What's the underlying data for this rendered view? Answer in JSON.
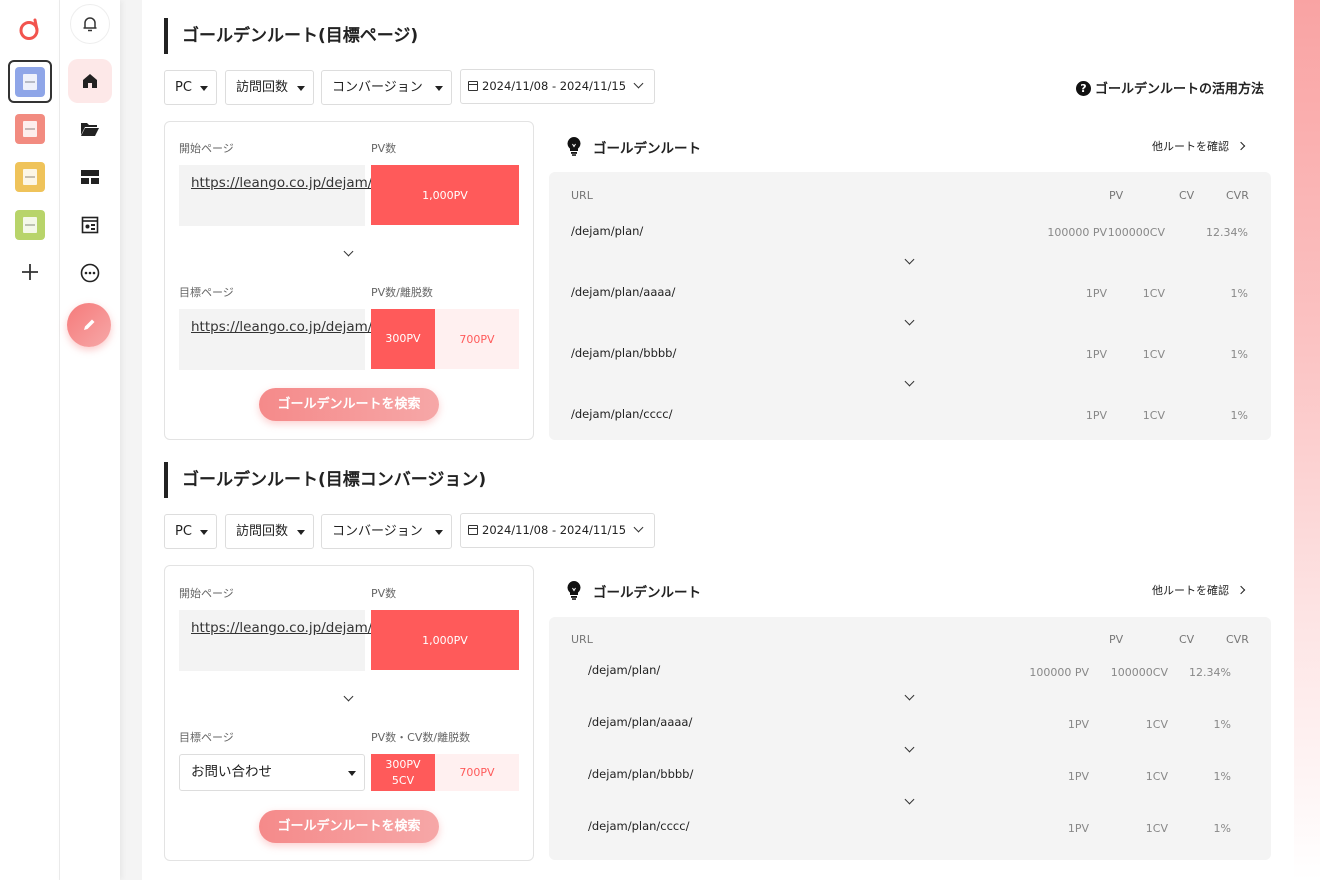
{
  "rail": {
    "logo": "logo-icon",
    "projects": [
      {
        "name": "project-blue",
        "color": "#8fa6e8",
        "active": true
      },
      {
        "name": "project-red",
        "color": "#f28b80"
      },
      {
        "name": "project-yellow",
        "color": "#efc35a"
      },
      {
        "name": "project-green",
        "color": "#b8d46a"
      }
    ],
    "add_icon": "plus-icon"
  },
  "nav": {
    "items": [
      "bell-icon",
      "home-icon",
      "folder-icon",
      "layout-icon",
      "report-icon",
      "more-icon",
      "edit-icon"
    ],
    "active": "home-icon"
  },
  "help_link": "ゴールデンルートの活用方法",
  "sections": [
    {
      "title": "ゴールデンルート(目標ページ)",
      "filters": {
        "device": "PC",
        "visits": "訪問回数",
        "type": "コンバージョン",
        "date_range": "2024/11/08 - 2024/11/15"
      },
      "start_label": "開始ページ",
      "pv_label": "PV数",
      "start_url": "https://leango.co.jp/dejam/",
      "start_pv": "1,000PV",
      "goal_label": "目標ページ",
      "goal_stat_label": "PV数/離脱数",
      "goal_url": "https://leango.co.jp/dejam/contact",
      "goal_pv": "300PV",
      "goal_exit": "700PV",
      "search_button": "ゴールデンルートを検索",
      "route_title": "ゴールデンルート",
      "other_routes": "他ルートを確認",
      "table_headers": {
        "url": "URL",
        "pv": "PV",
        "cv": "CV",
        "cvr": "CVR"
      },
      "rows": [
        {
          "url": "/dejam/plan/",
          "pv": "100000 PV",
          "cv": "100000CV",
          "cvr": "12.34%"
        },
        {
          "url": "/dejam/plan/aaaa/",
          "pv": "1PV",
          "cv": "1CV",
          "cvr": "1%"
        },
        {
          "url": "/dejam/plan/bbbb/",
          "pv": "1PV",
          "cv": "1CV",
          "cvr": "1%"
        },
        {
          "url": "/dejam/plan/cccc/",
          "pv": "1PV",
          "cv": "1CV",
          "cvr": "1%"
        }
      ]
    },
    {
      "title": "ゴールデンルート(目標コンバージョン)",
      "filters": {
        "device": "PC",
        "visits": "訪問回数",
        "type": "コンバージョン",
        "date_range": "2024/11/08 - 2024/11/15"
      },
      "start_label": "開始ページ",
      "pv_label": "PV数",
      "start_url": "https://leango.co.jp/dejam/",
      "start_pv": "1,000PV",
      "goal_label": "目標ページ",
      "goal_stat_label": "PV数・CV数/離脱数",
      "goal_select": "お問い合わせ",
      "goal_pv": "300PV",
      "goal_cv": "5CV",
      "goal_exit": "700PV",
      "search_button": "ゴールデンルートを検索",
      "route_title": "ゴールデンルート",
      "other_routes": "他ルートを確認",
      "table_headers": {
        "url": "URL",
        "pv": "PV",
        "cv": "CV",
        "cvr": "CVR"
      },
      "rows": [
        {
          "url": "/dejam/plan/",
          "pv": "100000 PV",
          "cv": "100000CV",
          "cvr": "12.34%"
        },
        {
          "url": "/dejam/plan/aaaa/",
          "pv": "1PV",
          "cv": "1CV",
          "cvr": "1%"
        },
        {
          "url": "/dejam/plan/bbbb/",
          "pv": "1PV",
          "cv": "1CV",
          "cvr": "1%"
        },
        {
          "url": "/dejam/plan/cccc/",
          "pv": "1PV",
          "cv": "1CV",
          "cvr": "1%"
        }
      ]
    }
  ]
}
